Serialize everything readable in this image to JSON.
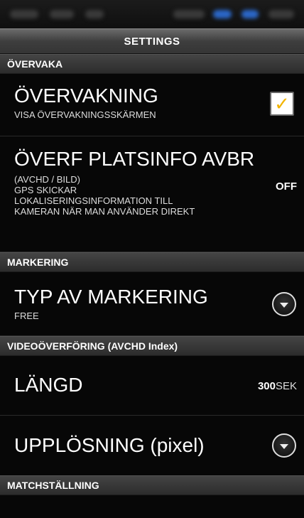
{
  "title": "SETTINGS",
  "sections": {
    "overvaka": {
      "header": "ÖVERVAKA",
      "monitoring": {
        "title": "ÖVERVAKNING",
        "subtitle": "VISA ÖVERVAKNINGSSKÄRMEN",
        "checked": true,
        "check_glyph": "✓"
      },
      "location": {
        "title": "ÖVERF PLATSINFO AVBR",
        "lines": [
          "(AVCHD / BILD)",
          "GPS SKICKAR",
          "LOKALISERINGSINFORMATION TILL",
          "KAMERAN NÄR MAN ANVÄNDER DIREKT"
        ],
        "value": "OFF"
      }
    },
    "markering": {
      "header": "MARKERING",
      "marker_type": {
        "title": "TYP AV MARKERING",
        "subtitle": "FREE"
      }
    },
    "video": {
      "header": "VIDEOÖVERFÖRING (AVCHD Index)",
      "length": {
        "title": "LÄNGD",
        "value": "300",
        "unit": "SEK"
      },
      "resolution": {
        "title": "UPPLÖSNING (pixel)"
      }
    },
    "match": {
      "header": "MATCHSTÄLLNING"
    }
  },
  "colors": {
    "check_accent": "#f2b400",
    "background": "#070707"
  },
  "icons": {
    "checkbox": "check-icon",
    "dropdown": "chevron-down-icon"
  }
}
